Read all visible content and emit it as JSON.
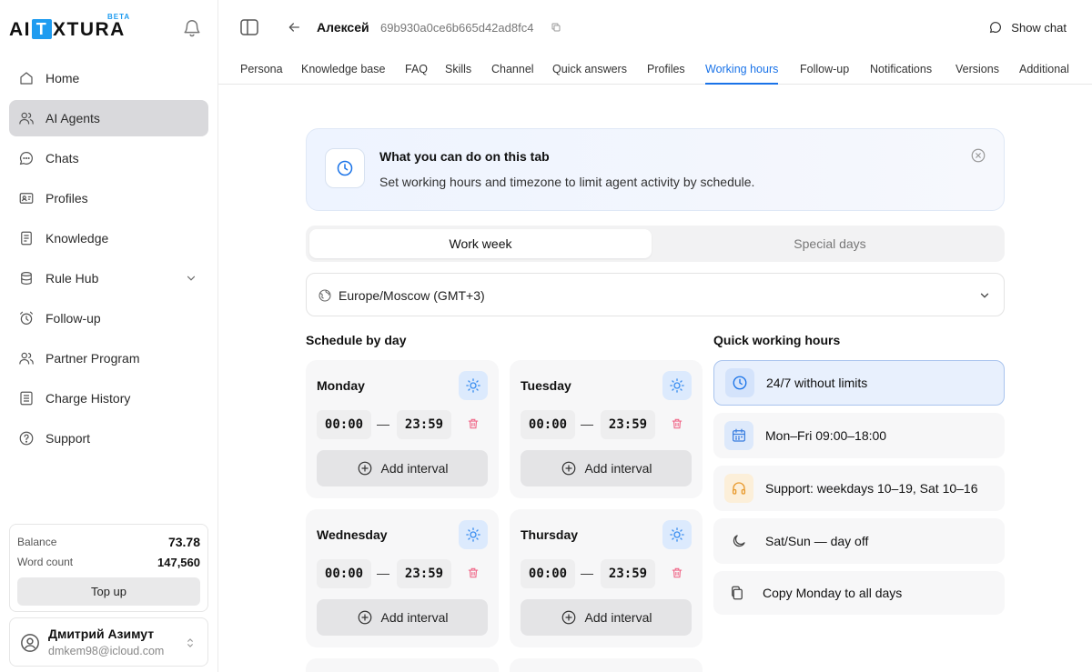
{
  "brand": {
    "logo_left": "AI",
    "logo_box": "T",
    "logo_right": "XTURA",
    "beta": "BETA"
  },
  "sidebar": {
    "items": [
      {
        "label": "Home",
        "icon": "home-icon"
      },
      {
        "label": "AI Agents",
        "icon": "users-icon",
        "active": true
      },
      {
        "label": "Chats",
        "icon": "chat-icon"
      },
      {
        "label": "Profiles",
        "icon": "id-card-icon"
      },
      {
        "label": "Knowledge",
        "icon": "document-icon"
      },
      {
        "label": "Rule Hub",
        "icon": "cylinder-icon"
      },
      {
        "label": "Follow-up",
        "icon": "alarm-icon"
      },
      {
        "label": "Partner Program",
        "icon": "users-icon"
      },
      {
        "label": "Charge History",
        "icon": "list-icon"
      },
      {
        "label": "Support",
        "icon": "help-icon"
      }
    ]
  },
  "balance": {
    "balance_label": "Balance",
    "balance_value": "73.78",
    "words_label": "Word count",
    "words_value": "147,560",
    "topup_label": "Top up"
  },
  "user": {
    "name": "Дмитрий Азимут",
    "email": "dmkem98@icloud.com"
  },
  "header": {
    "agent_name": "Алексей",
    "agent_id": "69b930a0ce6b665d42ad8fc4",
    "show_chat": "Show chat"
  },
  "tabs": [
    "Persona",
    "Knowledge base",
    "FAQ",
    "Skills",
    "Channel",
    "Quick answers",
    "Profiles",
    "Working hours",
    "Follow-up",
    "Notifications",
    "Versions",
    "Additional"
  ],
  "active_tab": "Working hours",
  "info": {
    "title": "What you can do on this tab",
    "description": "Set working hours and timezone to limit agent activity by schedule."
  },
  "segments": {
    "work_week": "Work week",
    "special_days": "Special days"
  },
  "timezone": "Europe/Moscow (GMT+3)",
  "schedule": {
    "title": "Schedule by day",
    "add_interval_label": "Add interval",
    "days": [
      {
        "name": "Monday",
        "from": "00:00",
        "to": "23:59"
      },
      {
        "name": "Tuesday",
        "from": "00:00",
        "to": "23:59"
      },
      {
        "name": "Wednesday",
        "from": "00:00",
        "to": "23:59"
      },
      {
        "name": "Thursday",
        "from": "00:00",
        "to": "23:59"
      }
    ]
  },
  "quick": {
    "title": "Quick working hours",
    "options": [
      {
        "label": "24/7 without limits",
        "icon": "clock-icon",
        "selected": true
      },
      {
        "label": "Mon–Fri 09:00–18:00",
        "icon": "calendar-icon"
      },
      {
        "label": "Support: weekdays 10–19, Sat 10–16",
        "icon": "headphones-icon"
      },
      {
        "label": "Sat/Sun — day off",
        "icon": "moon-icon"
      },
      {
        "label": "Copy Monday to all days",
        "icon": "copy-icon"
      }
    ]
  },
  "colors": {
    "accent": "#1a73e8",
    "logo_blue": "#1f9cf0",
    "trash_pink": "#f06a8a",
    "sun_blue": "#3b8ef0"
  }
}
